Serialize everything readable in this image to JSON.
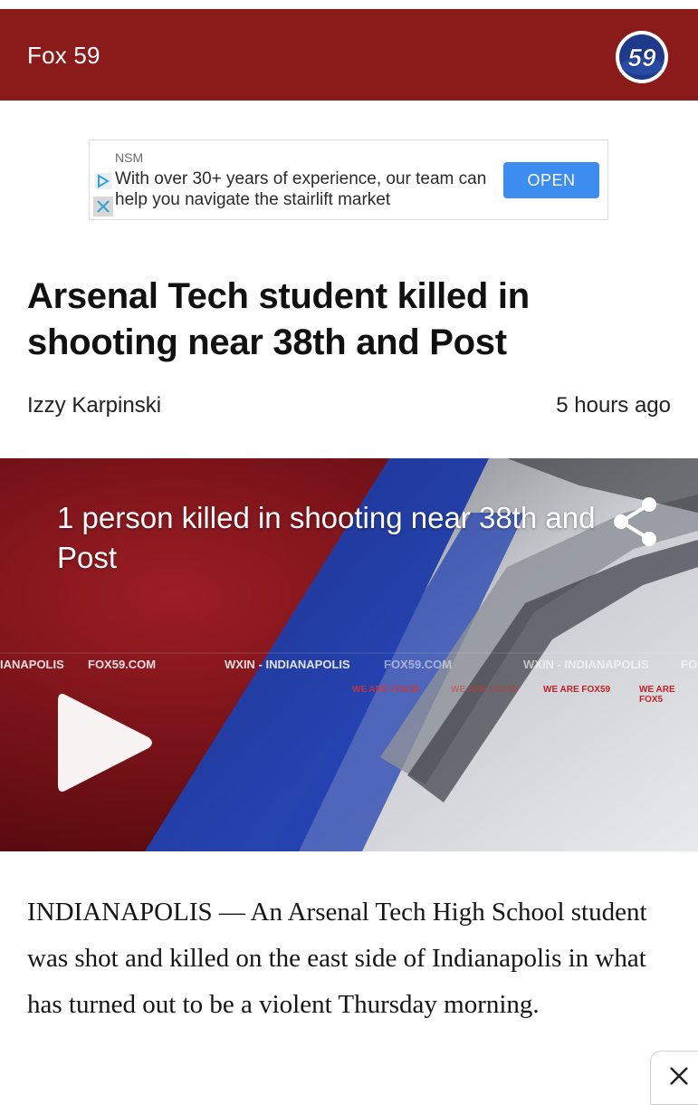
{
  "header": {
    "station_name": "Fox 59",
    "logo_text": "59",
    "bar_color": "#8b1a1a"
  },
  "ad": {
    "advertiser": "NSM",
    "message": "With over 30+ years of experience, our team can help you navigate the stairlift market",
    "cta_label": "OPEN",
    "cta_color": "#3d8cf0",
    "adchoices_icon": "adchoices-icon",
    "close_icon": "close-icon"
  },
  "article": {
    "headline": "Arsenal Tech student killed in shooting near 38th and Post",
    "author": "Izzy Karpinski",
    "published": "5 hours ago",
    "body": "INDIANAPOLIS — An Arsenal Tech High School student was shot and killed on the east side of Indianapolis in what has turned out to be a violent Thursday morning."
  },
  "video": {
    "title": "1 person killed in shooting near 38th and Post",
    "share_icon": "share-icon",
    "play_icon": "play-icon",
    "backdrop_texts": {
      "row1": [
        "IANAPOLIS",
        "FOX59.COM",
        "WXIN - INDIANAPOLIS",
        "FOX59.COM",
        "WXIN - INDIANAPOLIS",
        "FO"
      ],
      "row2": [
        "WE ARE FOX59",
        "WE ARE FOX59",
        "WE ARE FOX59",
        "WE ARE FOX5"
      ]
    }
  },
  "overlay": {
    "dismiss_icon": "close-icon"
  }
}
